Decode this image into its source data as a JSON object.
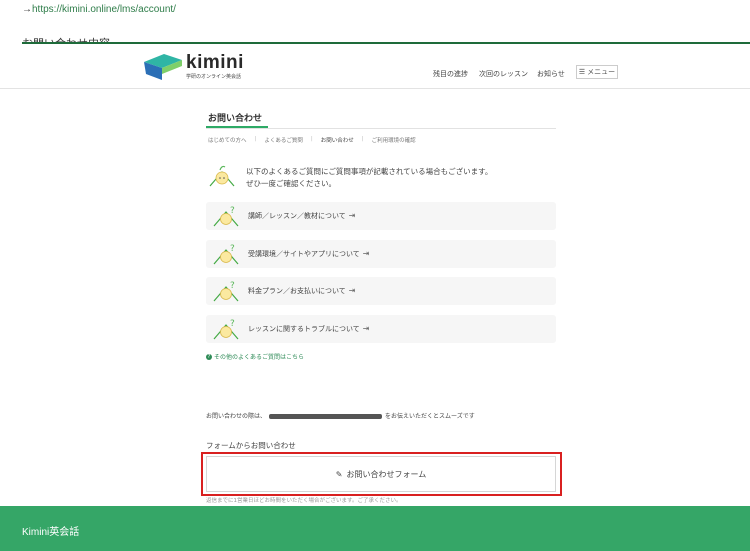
{
  "browser": {
    "url_prefix": "→",
    "url": "https://kimini.online/lms/account/"
  },
  "behind": {
    "title": "お問い合わせ内容"
  },
  "header": {
    "logo_text": "kimini",
    "logo_subtitle": "学研のオンライン英会話",
    "nav": [
      "残目の進捗",
      "次回のレッスン",
      "お知らせ"
    ],
    "menu_label": "メニュー",
    "menu_icon": "list-icon"
  },
  "main": {
    "section_title": "お問い合わせ",
    "subnav": [
      "はじめての方へ",
      "よくあるご質問",
      "お問い合わせ",
      "ご利用環境の確認"
    ],
    "intro": {
      "line1": "以下のよくあるご質問にご質問事項が記載されている場合もございます。",
      "line2": "ぜひ一度ご確認ください。"
    },
    "faq_items": [
      {
        "label": "講師／レッスン／教材について"
      },
      {
        "label": "受講環境／サイトやアプリについて"
      },
      {
        "label": "料金プラン／お支払いについて"
      },
      {
        "label": "レッスンに関するトラブルについて"
      }
    ],
    "more_link": "その他のよくあるご質問はこちら",
    "contact_note": {
      "before": "お問い合わせの際は、",
      "after": "をお伝えいただくとスムーズです"
    },
    "form_heading": "フォームからお問い合わせ",
    "form_button_label": "お問い合わせフォーム",
    "form_button_icon": "pencil-icon",
    "below_note": "返信までに1営業日ほどお時間をいただく場合がございます。ご了承ください。"
  },
  "footer": {
    "text": "Kimini英会話"
  },
  "colors": {
    "brand_green": "#35a667",
    "accent_green": "#2eaa66",
    "highlight_red": "#d92020",
    "logo_blue": "#2b6fb6",
    "logo_teal": "#2fb5a5"
  }
}
